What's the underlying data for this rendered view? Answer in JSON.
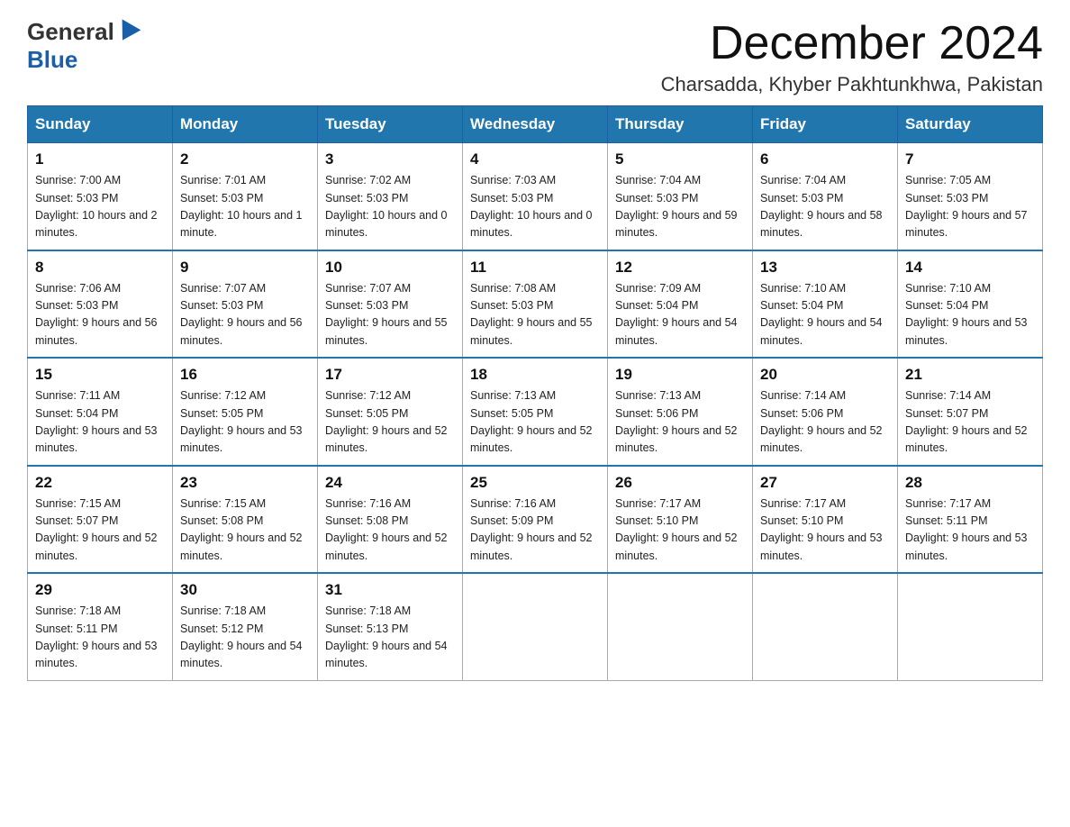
{
  "header": {
    "logo_general": "General",
    "logo_blue": "Blue",
    "month_title": "December 2024",
    "location": "Charsadda, Khyber Pakhtunkhwa, Pakistan"
  },
  "days_of_week": [
    "Sunday",
    "Monday",
    "Tuesday",
    "Wednesday",
    "Thursday",
    "Friday",
    "Saturday"
  ],
  "weeks": [
    [
      {
        "day": "1",
        "sunrise": "7:00 AM",
        "sunset": "5:03 PM",
        "daylight": "10 hours and 2 minutes."
      },
      {
        "day": "2",
        "sunrise": "7:01 AM",
        "sunset": "5:03 PM",
        "daylight": "10 hours and 1 minute."
      },
      {
        "day": "3",
        "sunrise": "7:02 AM",
        "sunset": "5:03 PM",
        "daylight": "10 hours and 0 minutes."
      },
      {
        "day": "4",
        "sunrise": "7:03 AM",
        "sunset": "5:03 PM",
        "daylight": "10 hours and 0 minutes."
      },
      {
        "day": "5",
        "sunrise": "7:04 AM",
        "sunset": "5:03 PM",
        "daylight": "9 hours and 59 minutes."
      },
      {
        "day": "6",
        "sunrise": "7:04 AM",
        "sunset": "5:03 PM",
        "daylight": "9 hours and 58 minutes."
      },
      {
        "day": "7",
        "sunrise": "7:05 AM",
        "sunset": "5:03 PM",
        "daylight": "9 hours and 57 minutes."
      }
    ],
    [
      {
        "day": "8",
        "sunrise": "7:06 AM",
        "sunset": "5:03 PM",
        "daylight": "9 hours and 56 minutes."
      },
      {
        "day": "9",
        "sunrise": "7:07 AM",
        "sunset": "5:03 PM",
        "daylight": "9 hours and 56 minutes."
      },
      {
        "day": "10",
        "sunrise": "7:07 AM",
        "sunset": "5:03 PM",
        "daylight": "9 hours and 55 minutes."
      },
      {
        "day": "11",
        "sunrise": "7:08 AM",
        "sunset": "5:03 PM",
        "daylight": "9 hours and 55 minutes."
      },
      {
        "day": "12",
        "sunrise": "7:09 AM",
        "sunset": "5:04 PM",
        "daylight": "9 hours and 54 minutes."
      },
      {
        "day": "13",
        "sunrise": "7:10 AM",
        "sunset": "5:04 PM",
        "daylight": "9 hours and 54 minutes."
      },
      {
        "day": "14",
        "sunrise": "7:10 AM",
        "sunset": "5:04 PM",
        "daylight": "9 hours and 53 minutes."
      }
    ],
    [
      {
        "day": "15",
        "sunrise": "7:11 AM",
        "sunset": "5:04 PM",
        "daylight": "9 hours and 53 minutes."
      },
      {
        "day": "16",
        "sunrise": "7:12 AM",
        "sunset": "5:05 PM",
        "daylight": "9 hours and 53 minutes."
      },
      {
        "day": "17",
        "sunrise": "7:12 AM",
        "sunset": "5:05 PM",
        "daylight": "9 hours and 52 minutes."
      },
      {
        "day": "18",
        "sunrise": "7:13 AM",
        "sunset": "5:05 PM",
        "daylight": "9 hours and 52 minutes."
      },
      {
        "day": "19",
        "sunrise": "7:13 AM",
        "sunset": "5:06 PM",
        "daylight": "9 hours and 52 minutes."
      },
      {
        "day": "20",
        "sunrise": "7:14 AM",
        "sunset": "5:06 PM",
        "daylight": "9 hours and 52 minutes."
      },
      {
        "day": "21",
        "sunrise": "7:14 AM",
        "sunset": "5:07 PM",
        "daylight": "9 hours and 52 minutes."
      }
    ],
    [
      {
        "day": "22",
        "sunrise": "7:15 AM",
        "sunset": "5:07 PM",
        "daylight": "9 hours and 52 minutes."
      },
      {
        "day": "23",
        "sunrise": "7:15 AM",
        "sunset": "5:08 PM",
        "daylight": "9 hours and 52 minutes."
      },
      {
        "day": "24",
        "sunrise": "7:16 AM",
        "sunset": "5:08 PM",
        "daylight": "9 hours and 52 minutes."
      },
      {
        "day": "25",
        "sunrise": "7:16 AM",
        "sunset": "5:09 PM",
        "daylight": "9 hours and 52 minutes."
      },
      {
        "day": "26",
        "sunrise": "7:17 AM",
        "sunset": "5:10 PM",
        "daylight": "9 hours and 52 minutes."
      },
      {
        "day": "27",
        "sunrise": "7:17 AM",
        "sunset": "5:10 PM",
        "daylight": "9 hours and 53 minutes."
      },
      {
        "day": "28",
        "sunrise": "7:17 AM",
        "sunset": "5:11 PM",
        "daylight": "9 hours and 53 minutes."
      }
    ],
    [
      {
        "day": "29",
        "sunrise": "7:18 AM",
        "sunset": "5:11 PM",
        "daylight": "9 hours and 53 minutes."
      },
      {
        "day": "30",
        "sunrise": "7:18 AM",
        "sunset": "5:12 PM",
        "daylight": "9 hours and 54 minutes."
      },
      {
        "day": "31",
        "sunrise": "7:18 AM",
        "sunset": "5:13 PM",
        "daylight": "9 hours and 54 minutes."
      },
      null,
      null,
      null,
      null
    ]
  ]
}
